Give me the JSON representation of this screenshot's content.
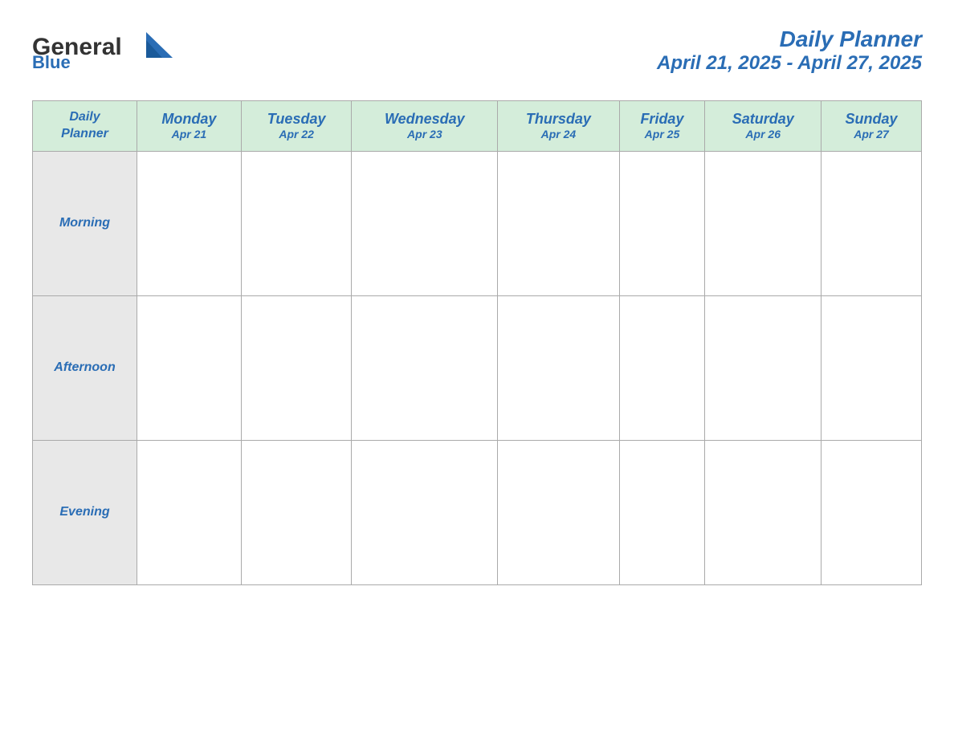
{
  "header": {
    "logo": {
      "general": "General",
      "blue": "Blue"
    },
    "title": "Daily Planner",
    "date_range": "April 21, 2025 - April 27, 2025"
  },
  "table": {
    "corner_label_line1": "Daily",
    "corner_label_line2": "Planner",
    "columns": [
      {
        "day": "Monday",
        "date": "Apr 21"
      },
      {
        "day": "Tuesday",
        "date": "Apr 22"
      },
      {
        "day": "Wednesday",
        "date": "Apr 23"
      },
      {
        "day": "Thursday",
        "date": "Apr 24"
      },
      {
        "day": "Friday",
        "date": "Apr 25"
      },
      {
        "day": "Saturday",
        "date": "Apr 26"
      },
      {
        "day": "Sunday",
        "date": "Apr 27"
      }
    ],
    "rows": [
      {
        "label": "Morning"
      },
      {
        "label": "Afternoon"
      },
      {
        "label": "Evening"
      }
    ]
  }
}
